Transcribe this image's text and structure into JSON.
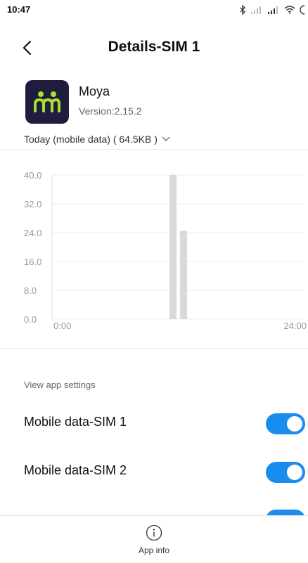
{
  "status_bar": {
    "time": "10:47",
    "icons": [
      "bluetooth-icon",
      "signal-sim1-icon",
      "signal-sim2-icon",
      "wifi-icon",
      "battery-icon"
    ]
  },
  "header": {
    "title": "Details-SIM 1",
    "back_icon": "chevron-left-icon"
  },
  "app": {
    "name": "Moya",
    "version": "Version:2.15.2",
    "icon_bg": "#1f1c3d",
    "icon_accent": "#a8e030"
  },
  "usage": {
    "selector_label": "Today (mobile data) ( 64.5KB )",
    "dropdown_icon": "chevron-down-icon"
  },
  "chart_data": {
    "type": "bar",
    "title": "",
    "xlabel": "",
    "ylabel": "",
    "ylim": [
      0,
      40
    ],
    "y_ticks": [
      "40.0",
      "32.0",
      "24.0",
      "16.0",
      "8.0",
      "0.0"
    ],
    "x_ticks": [
      "0:00",
      "24:00"
    ],
    "grid": true,
    "bars": [
      {
        "hour": 11,
        "value": 40.0
      },
      {
        "hour": 12,
        "value": 24.5
      }
    ],
    "bar_color": "#d9d9d9"
  },
  "settings": {
    "section_label": "View app settings",
    "toggles": [
      {
        "label": "Mobile data-SIM 1",
        "on": true
      },
      {
        "label": "Mobile data-SIM 2",
        "on": true
      }
    ],
    "accent": "#1a8cf0"
  },
  "bottom_bar": {
    "app_info_label": "App info",
    "app_info_icon": "info-icon"
  }
}
